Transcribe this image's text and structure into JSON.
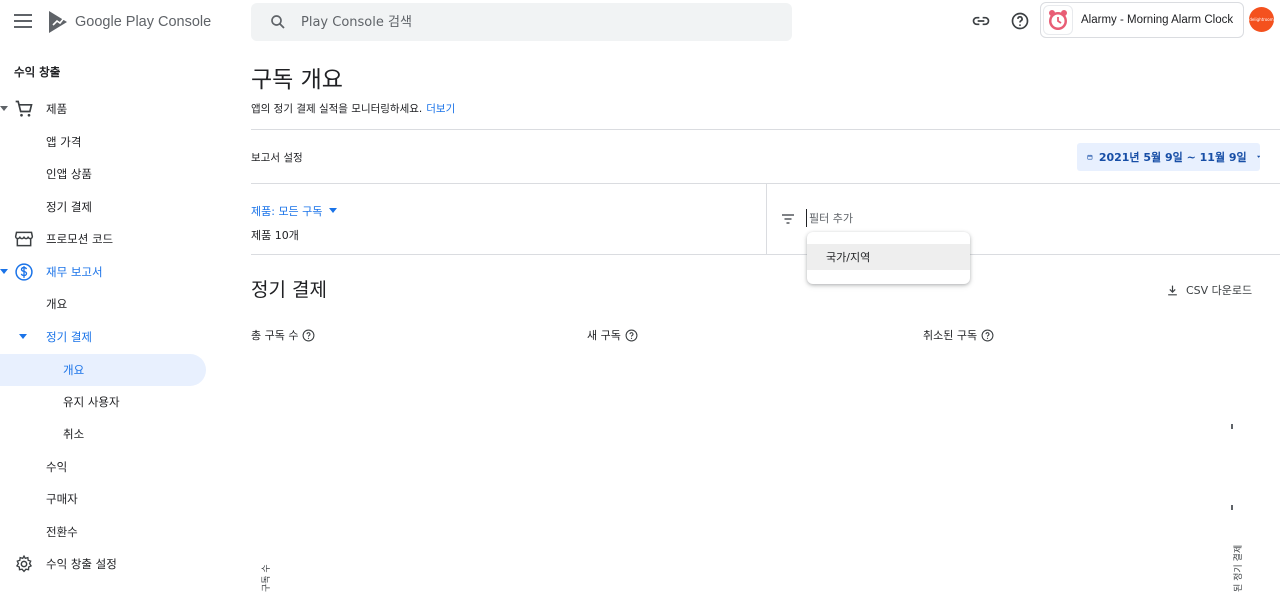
{
  "header": {
    "logo_text": "Google Play Console",
    "search_placeholder": "Play Console 검색",
    "app_name": "Alarmy - Morning Alarm Clock",
    "avatar_text": "delightroom"
  },
  "sidebar": {
    "section_title": "수익 창출",
    "items": [
      {
        "label": "제품"
      },
      {
        "label": "앱 가격"
      },
      {
        "label": "인앱 상품"
      },
      {
        "label": "정기 결제"
      },
      {
        "label": "프로모션 코드"
      },
      {
        "label": "재무 보고서"
      },
      {
        "label": "개요"
      },
      {
        "label": "정기 결제"
      },
      {
        "label": "개요"
      },
      {
        "label": "유지 사용자"
      },
      {
        "label": "취소"
      },
      {
        "label": "수익"
      },
      {
        "label": "구매자"
      },
      {
        "label": "전환수"
      },
      {
        "label": "수익 창출 설정"
      }
    ]
  },
  "main": {
    "title": "구독 개요",
    "description": "앱의 정기 결제 실적을 모니터링하세요.",
    "learn_more": "더보기",
    "report_settings": "보고서 설정",
    "date_range": "2021년 5월 9일 ~ 11월 9일",
    "product_filter": "제품: 모든 구독",
    "product_count": "제품 10개",
    "filter_placeholder": "필터 추가",
    "filter_option": "국가/지역",
    "section_title": "정기 결제",
    "csv_download": "CSV 다운로드",
    "metrics": [
      "총 구독 수",
      "새 구독",
      "취소된 구독"
    ],
    "rotated_left": "구독 수",
    "rotated_right": "된 정기 결제"
  },
  "colors": {
    "accent": "#1a73e8",
    "active_bg": "#e8f0fe",
    "avatar": "#f4511e"
  }
}
